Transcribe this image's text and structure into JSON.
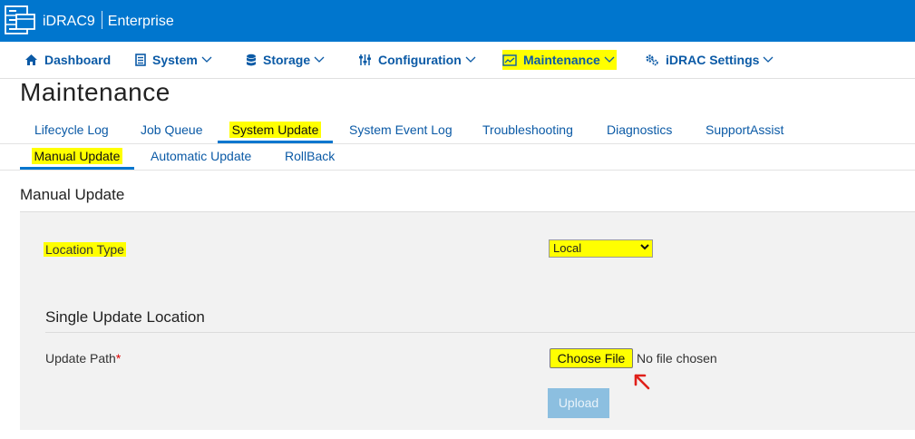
{
  "header": {
    "product": "iDRAC9",
    "edition": "Enterprise"
  },
  "nav": {
    "dashboard": "Dashboard",
    "system": "System",
    "storage": "Storage",
    "configuration": "Configuration",
    "maintenance": "Maintenance",
    "idrac_settings": "iDRAC Settings"
  },
  "page": {
    "title": "Maintenance"
  },
  "tabs": [
    "Lifecycle Log",
    "Job Queue",
    "System Update",
    "System Event Log",
    "Troubleshooting",
    "Diagnostics",
    "SupportAssist"
  ],
  "active_tab": "System Update",
  "subtabs": [
    "Manual Update",
    "Automatic Update",
    "RollBack"
  ],
  "active_subtab": "Manual Update",
  "manual_update": {
    "title": "Manual Update",
    "location_type_label": "Location Type",
    "location_type_value": "Local",
    "single_update_title": "Single Update Location",
    "update_path_label": "Update Path",
    "required_mark": "*",
    "choose_file_label": "Choose File",
    "no_file_text": "No file chosen",
    "upload_label": "Upload"
  },
  "colors": {
    "brand_blue": "#0076ce",
    "highlight": "#ffff00",
    "link": "#0b5aa6",
    "annotation_arrow": "#e0201a"
  }
}
